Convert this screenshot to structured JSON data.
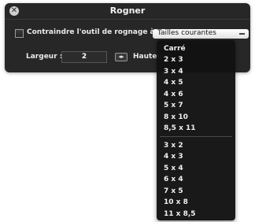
{
  "window": {
    "title": "Rogner",
    "close_glyph": "✕"
  },
  "options": {
    "constrain_label": "Contraindre l'outil de rognage à :",
    "constrain_checked": false,
    "preset_value": "Tailles courantes"
  },
  "dimensions": {
    "width_label": "Largeur :",
    "width_value": "2",
    "swap_icon": "◂▸",
    "height_label": "Hauteu"
  },
  "menu": {
    "group1": [
      "Carré",
      "2 x 3",
      "3 x 4",
      "4 x 5",
      "4 x 6",
      "5 x 7",
      "8 x 10",
      "8,5 x 11"
    ],
    "group2": [
      "3 x 2",
      "4 x 3",
      "5 x 4",
      "6 x 4",
      "7 x 5",
      "10 x 8",
      "11 x 8,5"
    ]
  }
}
